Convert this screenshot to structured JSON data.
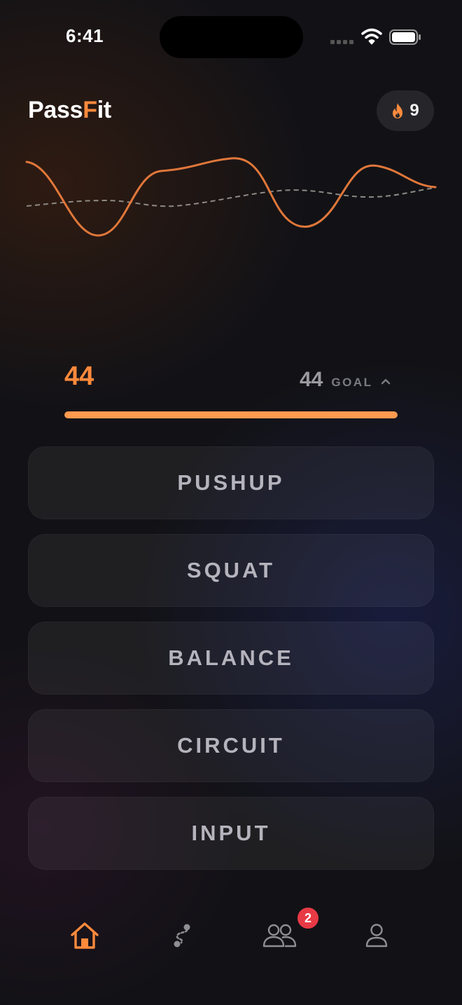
{
  "status_bar": {
    "time": "6:41"
  },
  "header": {
    "logo_prefix": "Pass",
    "logo_f": "F",
    "logo_suffix": "it",
    "streak_count": "9",
    "streak_icon": "flame-icon"
  },
  "progress": {
    "current": "44",
    "goal": "44",
    "goal_label": "GOAL",
    "fraction": 1.0
  },
  "exercises": [
    {
      "label": "PUSHUP"
    },
    {
      "label": "SQUAT"
    },
    {
      "label": "BALANCE"
    },
    {
      "label": "CIRCUIT"
    },
    {
      "label": "INPUT"
    }
  ],
  "tab_bar": {
    "items": [
      {
        "icon": "home-icon",
        "active": true
      },
      {
        "icon": "route-icon",
        "active": false
      },
      {
        "icon": "friends-icon",
        "active": false,
        "badge": "2"
      },
      {
        "icon": "profile-icon",
        "active": false
      }
    ]
  },
  "colors": {
    "accent": "#ff8a3c",
    "progress": "#ff9a4f",
    "button_text": "#b5b3bc",
    "badge": "#e83a45",
    "inactive_icon": "#8e8e94"
  }
}
